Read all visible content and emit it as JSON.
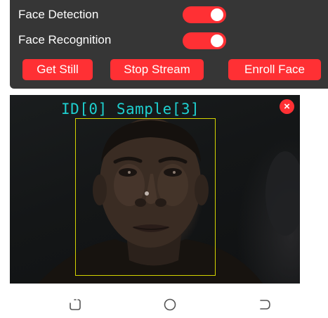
{
  "controls": {
    "face_detection": {
      "label": "Face Detection",
      "enabled": true
    },
    "face_recognition": {
      "label": "Face Recognition",
      "enabled": true
    }
  },
  "buttons": {
    "get_still": "Get Still",
    "stop_stream": "Stop Stream",
    "enroll_face": "Enroll Face"
  },
  "stream": {
    "overlay_label": "ID[0] Sample[3]",
    "close_symbol": "×"
  },
  "navbar": {
    "icons": [
      "recent-apps-icon",
      "home-icon",
      "back-icon"
    ]
  },
  "colors": {
    "accent": "#ff3034",
    "panel": "#363636",
    "face_box": "#d4d400",
    "label_text": "#1ecfcf"
  }
}
